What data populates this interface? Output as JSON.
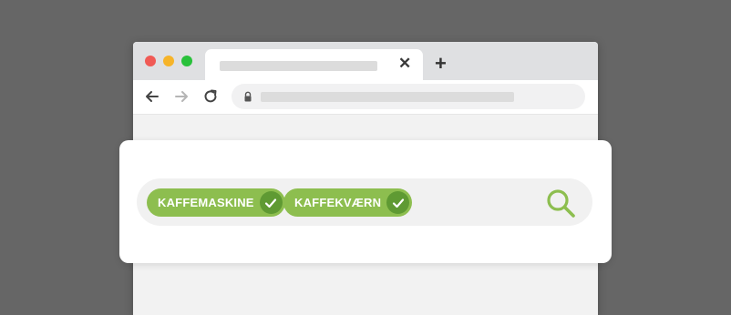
{
  "browser": {
    "tab": {
      "title": "",
      "close_icon": "close-icon"
    },
    "new_tab_icon": "plus-icon",
    "nav": {
      "back_icon": "arrow-left-icon",
      "forward_icon": "arrow-right-icon",
      "reload_icon": "reload-icon"
    },
    "address": {
      "lock_icon": "lock-icon",
      "url": ""
    }
  },
  "search": {
    "tags": [
      {
        "label": "KAFFEMASKINE",
        "icon": "check-icon"
      },
      {
        "label": "KAFFEKVÆRN",
        "icon": "check-icon"
      }
    ],
    "search_icon": "search-icon",
    "colors": {
      "chip": "#8dbe4f",
      "chip_check": "#5f9a33",
      "search_icon": "#8dbe4f"
    }
  }
}
